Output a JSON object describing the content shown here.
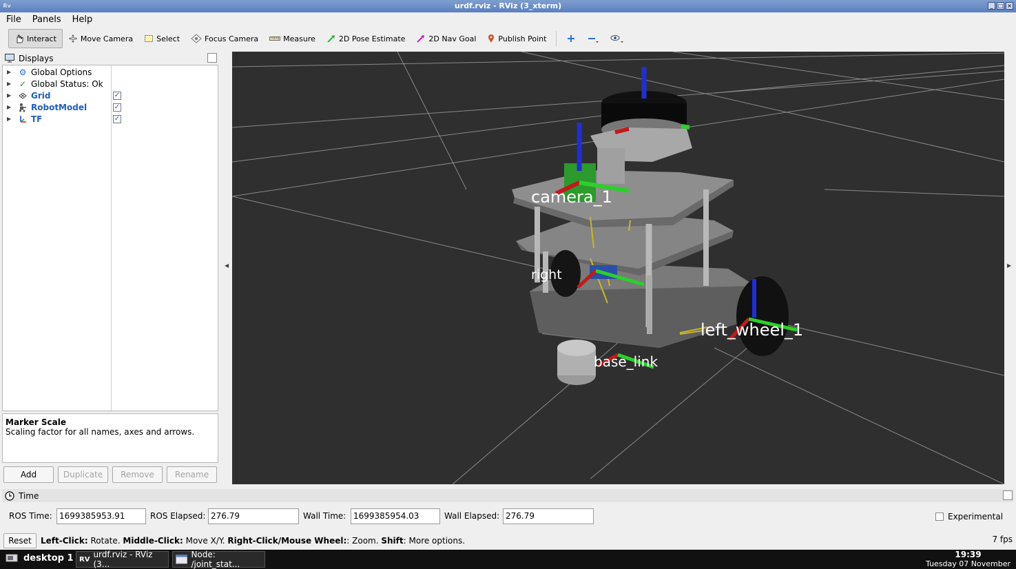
{
  "window": {
    "title": "urdf.rviz - RViz (3_xterm)"
  },
  "menu": [
    "File",
    "Panels",
    "Help"
  ],
  "toolbar": {
    "tools": [
      {
        "label": "Interact",
        "icon": "hand-cursor-icon",
        "active": true
      },
      {
        "label": "Move Camera",
        "icon": "move-camera-icon"
      },
      {
        "label": "Select",
        "icon": "select-box-icon"
      },
      {
        "label": "Focus Camera",
        "icon": "focus-camera-icon"
      },
      {
        "label": "Measure",
        "icon": "ruler-icon"
      },
      {
        "label": "2D Pose Estimate",
        "icon": "green-arrow-icon"
      },
      {
        "label": "2D Nav Goal",
        "icon": "magenta-arrow-icon"
      },
      {
        "label": "Publish Point",
        "icon": "map-pin-icon"
      }
    ]
  },
  "displays": {
    "title": "Displays",
    "items": [
      {
        "label": "Global Options",
        "icon": "gear-icon",
        "checked": null
      },
      {
        "label": "Global Status: Ok",
        "icon": "checkmark-icon",
        "checked": null
      },
      {
        "label": "Grid",
        "icon": "grid-icon",
        "checked": true
      },
      {
        "label": "RobotModel",
        "icon": "robot-icon",
        "checked": true
      },
      {
        "label": "TF",
        "icon": "tf-axes-icon",
        "checked": true
      }
    ],
    "description_title": "Marker Scale",
    "description_text": "Scaling factor for all names, axes and arrows.",
    "buttons": {
      "add": "Add",
      "duplicate": "Duplicate",
      "remove": "Remove",
      "rename": "Rename"
    }
  },
  "view": {
    "frame_labels": [
      "camera_1",
      "right",
      "left_wheel_1",
      "base_link"
    ],
    "background_color": "#2f2f2f"
  },
  "time": {
    "title": "Time",
    "ros_time_label": "ROS Time:",
    "ros_time": "1699385953.91",
    "ros_elapsed_label": "ROS Elapsed:",
    "ros_elapsed": "276.79",
    "wall_time_label": "Wall Time:",
    "wall_time": "1699385954.03",
    "wall_elapsed_label": "Wall Elapsed:",
    "wall_elapsed": "276.79",
    "experimental": "Experimental"
  },
  "status": {
    "reset": "Reset",
    "hint_parts": [
      {
        "bold": "Left-Click:",
        "text": " Rotate. "
      },
      {
        "bold": "Middle-Click:",
        "text": " Move X/Y. "
      },
      {
        "bold": "Right-Click/Mouse Wheel:",
        "text": ": Zoom. "
      },
      {
        "bold": "Shift",
        "text": ": More options."
      }
    ],
    "fps": "7 fps"
  },
  "taskbar": {
    "desktop": "desktop 1",
    "tasks": [
      "urdf.rviz - RViz (3...",
      "Node: /joint_stat..."
    ],
    "time": "19:39",
    "date": "Tuesday 07 November"
  }
}
